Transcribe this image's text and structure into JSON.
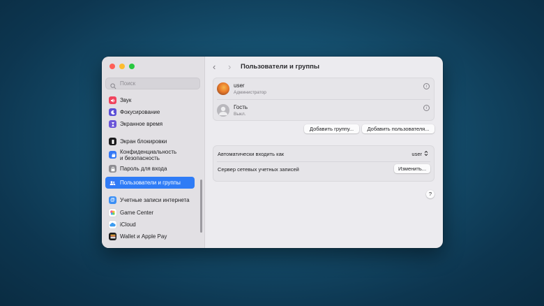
{
  "window": {
    "traffic_lights": [
      {
        "name": "close",
        "color": "#ff5f57"
      },
      {
        "name": "minimize",
        "color": "#febc2e"
      },
      {
        "name": "zoom",
        "color": "#28c840"
      }
    ]
  },
  "sidebar": {
    "search_placeholder": "Поиск",
    "items": [
      {
        "label": "Звук",
        "icon": "speaker-icon",
        "color": "#f0445e"
      },
      {
        "label": "Фокусирование",
        "icon": "moon-icon",
        "color": "#5b4fd6"
      },
      {
        "label": "Экранное время",
        "icon": "hourglass-icon",
        "color": "#6a55d8"
      },
      {
        "label": "Экран блокировки",
        "icon": "lock-screen-icon",
        "color": "#1c1c1e"
      },
      {
        "label": "Конфиденциальность\nи безопасность",
        "icon": "hand-icon",
        "color": "#3478f6"
      },
      {
        "label": "Пароль для входа",
        "icon": "lock-icon",
        "color": "#8e8d92"
      },
      {
        "label": "Пользователи и группы",
        "icon": "users-icon",
        "color": "#3478f6",
        "selected": true
      },
      {
        "label": "Учетные записи интернета",
        "icon": "at-icon",
        "color": "#3b8ff5"
      },
      {
        "label": "Game Center",
        "icon": "game-center-icon",
        "color": "#ffffff"
      },
      {
        "label": "iCloud",
        "icon": "cloud-icon",
        "color": "#ffffff"
      },
      {
        "label": "Wallet и Apple Pay",
        "icon": "wallet-icon",
        "color": "#1c1c1e"
      }
    ]
  },
  "toolbar": {
    "back": "‹",
    "forward": "›",
    "title": "Пользователи и группы"
  },
  "users": [
    {
      "name": "user",
      "role": "Администратор"
    },
    {
      "name": "Гость",
      "role": "Выкл."
    }
  ],
  "buttons": {
    "add_group": "Добавить группу...",
    "add_user": "Добавить пользователя...",
    "change": "Изменить..."
  },
  "settings": {
    "auto_login_label": "Автоматически входить как",
    "auto_login_value": "user",
    "network_server_label": "Сервер сетевых учетных записей"
  },
  "help_label": "?"
}
